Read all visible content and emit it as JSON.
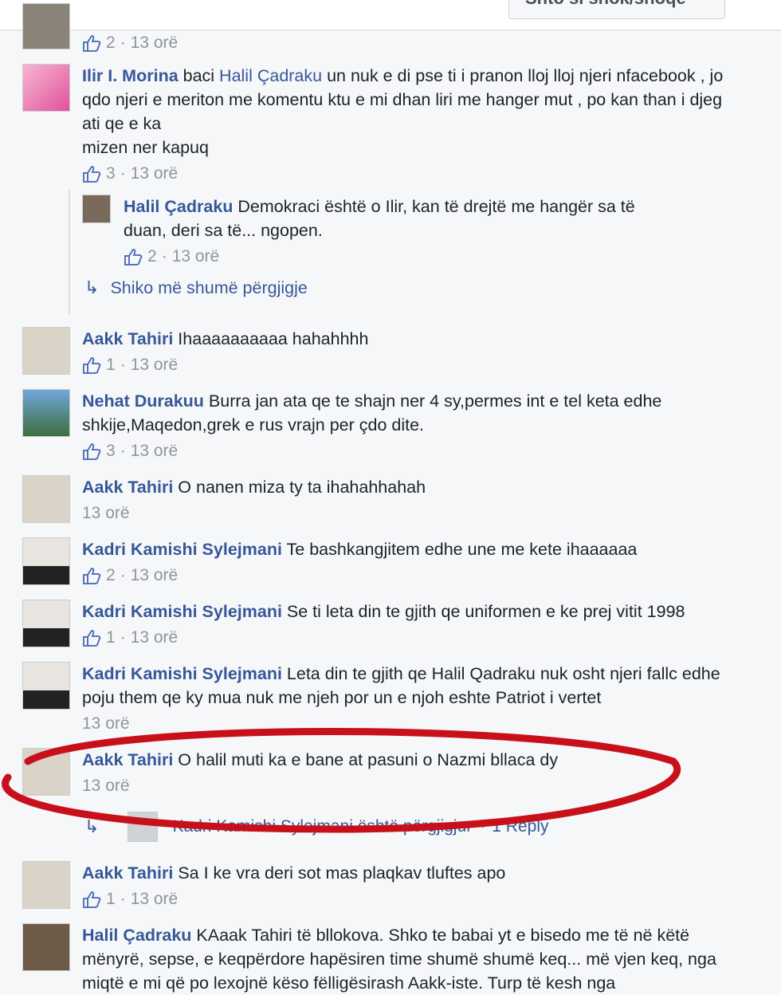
{
  "topbar": {
    "button_label": "Shto si shok/shoqe"
  },
  "comments": [
    {
      "meta": {
        "likes": "2",
        "time": "13 orë"
      }
    },
    {
      "name": "Ilir I. Morina",
      "pre": " baci ",
      "mention": "Halil Çadraku",
      "text": " un nuk e di pse ti i pranon lloj lloj njeri nfacebook , jo qdo njeri e meriton me komentu ktu e mi dhan liri me hanger mut , po kan than i djeg ati qe e ka",
      "text2": "mizen ner kapuq",
      "likes": "3",
      "time": "13 orë"
    },
    {
      "name": "Halil Çadraku",
      "text": " Demokraci është o Ilir, kan të drejtë me hangër sa të duan, deri sa të... ngopen.",
      "likes": "2",
      "time": "13 orë"
    },
    {
      "name": "Aakk Tahiri",
      "text": " Ihaaaaaaaaaa hahahhhh",
      "likes": "1",
      "time": "13 orë"
    },
    {
      "name": "Nehat Durakuu",
      "text": " Burra jan ata qe te shajn ner 4 sy,permes int e tel keta edhe shkije,Maqedon,grek e rus vrajn per çdo dite.",
      "likes": "3",
      "time": "13 orë"
    },
    {
      "name": "Aakk Tahiri",
      "text": " O nanen miza ty ta ihahahhahah",
      "time": "13 orë"
    },
    {
      "name": "Kadri Kamishi Sylejmani",
      "text": " Te bashkangjitem edhe une me kete ihaaaaaa",
      "likes": "2",
      "time": "13 orë"
    },
    {
      "name": "Kadri Kamishi Sylejmani",
      "text": " Se ti leta din te gjith qe uniformen e ke prej vitit 1998",
      "likes": "1",
      "time": "13 orë"
    },
    {
      "name": "Kadri Kamishi Sylejmani",
      "text": " Leta din te gjith qe Halil Qadraku nuk osht njeri fallc edhe poju them qe ky mua nuk me njeh por un e njoh eshte Patriot i vertet",
      "time": "13 orë"
    },
    {
      "name": "Aakk Tahiri",
      "text": " O halil muti ka e bane at pasuni o Nazmi bllaca dy",
      "time": "13 orë"
    },
    {
      "name": "Aakk Tahiri",
      "text": " Sa I ke vra deri sot mas plaqkav tluftes apo",
      "likes": "1",
      "time": "13 orë"
    },
    {
      "name": "Halil Çadraku",
      "text": " KAaak Tahiri të bllokova. Shko te babai yt e bisedo me të në këtë mënyrë, sepse, e keqpërdore hapësiren time shumë shumë keq... më vjen keq, nga miqtë e mi që po lexojnë këso fëlligësirash Aakk-iste. Turp të kesh nga"
    }
  ],
  "more_replies": "Shiko më shumë përgjigje",
  "replied_line": {
    "text": "Kadri Kamishi Sylejmani është përgjigjur",
    "sep": "·",
    "reply": "1 Reply"
  },
  "colors": {
    "link": "#365899",
    "meta": "#90949c",
    "highlight": "#c8101a"
  }
}
